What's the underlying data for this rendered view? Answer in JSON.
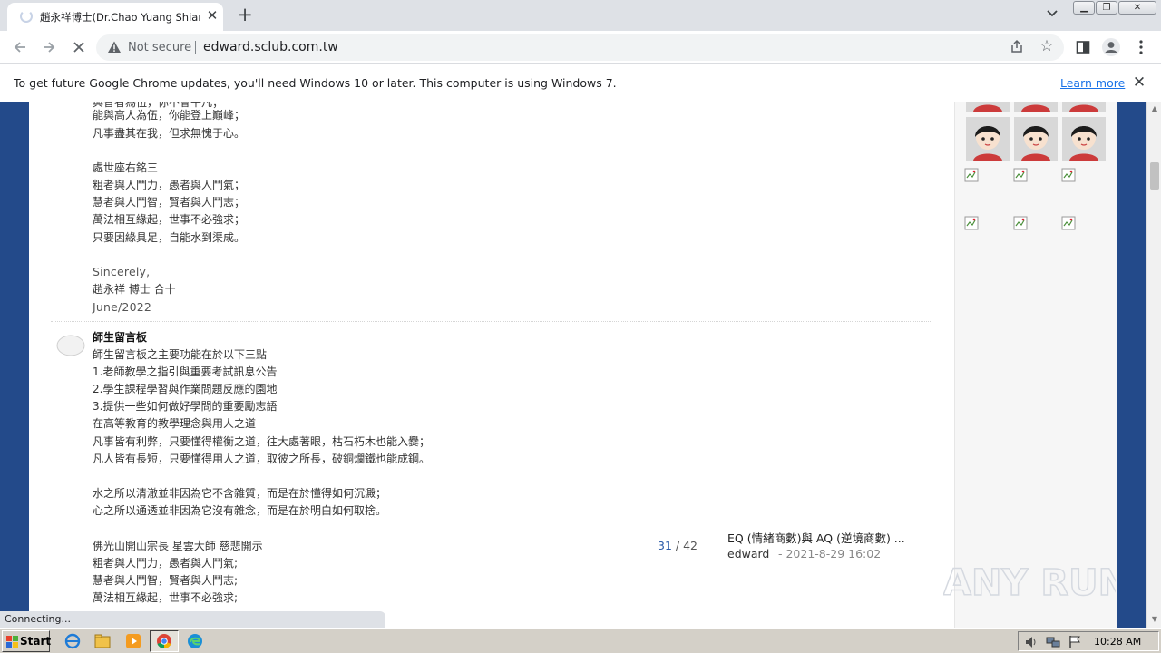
{
  "browser": {
    "tab_title": "趙永祥博士(Dr.Chao Yuang Shiang)",
    "not_secure_label": "Not secure",
    "url": "edward.sclub.com.tw",
    "icons": [
      "back-icon",
      "forward-icon",
      "stop-loading-icon",
      "warning-icon",
      "share-icon",
      "star-icon",
      "side-panel-icon",
      "profile-icon",
      "menu-icon"
    ]
  },
  "infobar": {
    "message": "To get future Google Chrome updates, you'll need Windows 10 or later. This computer is using Windows 7.",
    "link": "Learn more"
  },
  "article": {
    "clipped_line": "與智者為伍，你不會平凡；",
    "block1": [
      "能與高人為伍，你能登上巔峰；",
      "凡事盡其在我，但求無愧于心。"
    ],
    "block2_title": "處世座右銘三",
    "block2": [
      "粗者與人鬥力，愚者與人鬥氣；",
      "慧者與人鬥智，賢者與人鬥志；",
      "萬法相互緣起，世事不必強求；",
      "只要因緣具足，自能水到渠成。"
    ],
    "sign": [
      "Sincerely,",
      "趙永祥  博士 合十",
      "June/2022"
    ]
  },
  "post": {
    "title": "師生留言板",
    "lines": [
      "師生留言板之主要功能在於以下三點",
      "1.老師教學之指引與重要考試訊息公告",
      "2.學生課程學習與作業問題反應的園地",
      "3.提供一些如何做好學問的重要勵志語",
      "在高等教育的教學理念與用人之道",
      "凡事皆有利弊，只要懂得權衡之道，往大處著眼，枯石朽木也能入爨；",
      "凡人皆有長短，只要懂得用人之道，取彼之所長，破銅爛鐵也能成鋼。"
    ],
    "lines2": [
      "水之所以清澈並非因為它不含雜質，而是在於懂得如何沉澱；",
      "心之所以通透並非因為它沒有雜念，而是在於明白如何取捨。"
    ],
    "lines3": [
      "佛光山開山宗長 星雲大師 慈悲開示",
      "粗者與人鬥力，愚者與人鬥氣;",
      "慧者與人鬥智，賢者與人鬥志;",
      "萬法相互緣起，世事不必強求;"
    ]
  },
  "pager": {
    "current": "31",
    "sep": " / ",
    "total": "42"
  },
  "related": {
    "title": "EQ (情緒商數)與 AQ (逆境商數) ...",
    "author": "edward",
    "date": "- 2021-8-29 16:02"
  },
  "status_text": "Connecting...",
  "taskbar": {
    "start_label": "Start",
    "time": "10:28 AM"
  },
  "watermark": "ANY RUN",
  "colors": {
    "page_bg": "#234a8a",
    "link": "#1a73e8",
    "pager_current": "#2a5aa8"
  }
}
